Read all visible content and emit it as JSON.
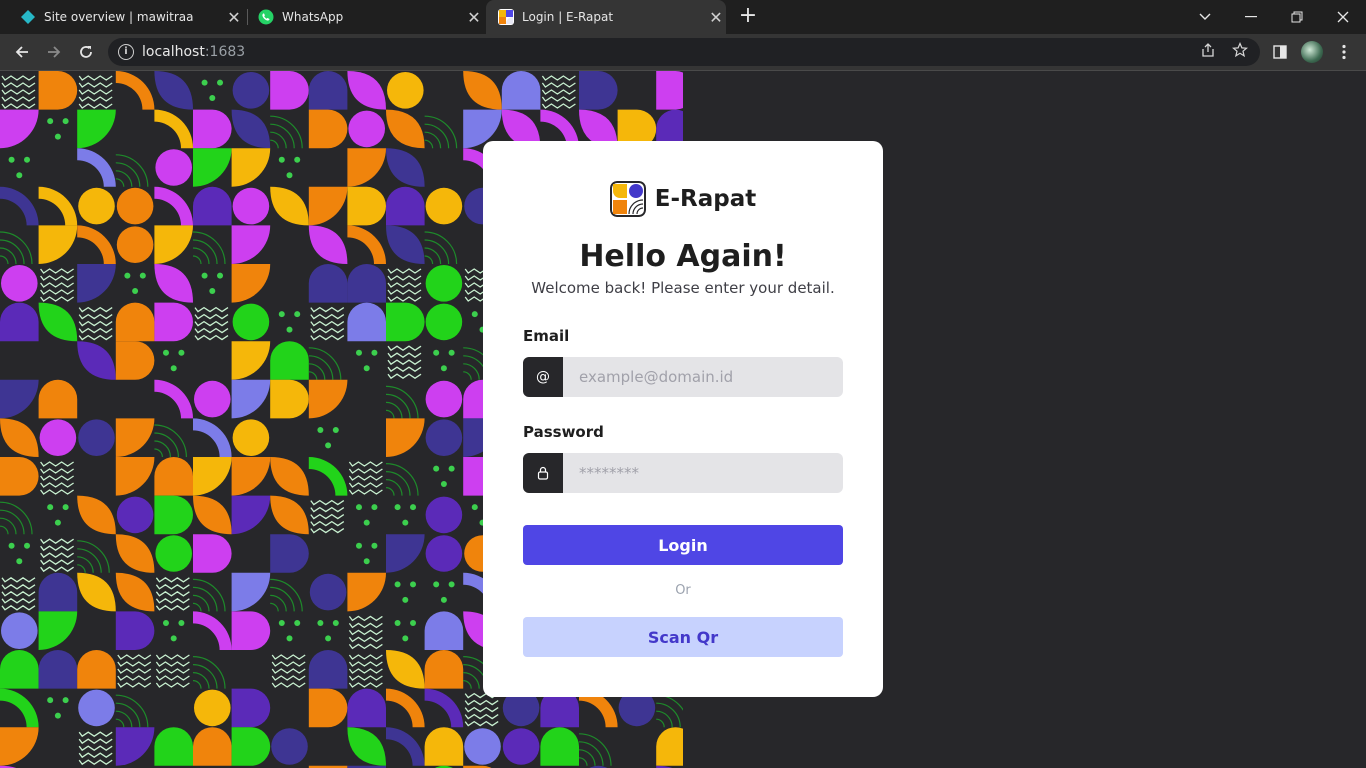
{
  "browser": {
    "tabs": [
      {
        "title": "Site overview | mawitraa",
        "favicon": "diamond-icon",
        "active": false
      },
      {
        "title": "WhatsApp",
        "favicon": "whatsapp-icon",
        "active": false
      },
      {
        "title": "Login | E-Rapat",
        "favicon": "erapat-logo-icon",
        "active": true
      }
    ],
    "url_host": "localhost",
    "url_port": ":1683"
  },
  "brand": {
    "name": "E-Rapat"
  },
  "login": {
    "heading": "Hello Again!",
    "subtitle": "Welcome back! Please enter your detail.",
    "email_label": "Email",
    "email_placeholder": "example@domain.id",
    "email_icon": "@",
    "password_label": "Password",
    "password_placeholder": "********",
    "login_button": "Login",
    "or_text": "Or",
    "scan_button": "Scan Qr"
  },
  "colors": {
    "page_bg": "#27272a",
    "primary": "#4f46e5",
    "secondary_bg": "#c7d2fe",
    "secondary_text": "#4338ca",
    "pattern_orange": "#f0840c",
    "pattern_yellow": "#f5b70a",
    "pattern_green": "#22d31a",
    "pattern_magenta": "#cd3ff0",
    "pattern_indigo": "#3e3593",
    "pattern_purple": "#5b2ab8",
    "pattern_lavender": "#7c7ce8",
    "pattern_mint": "#c8f0d0"
  }
}
